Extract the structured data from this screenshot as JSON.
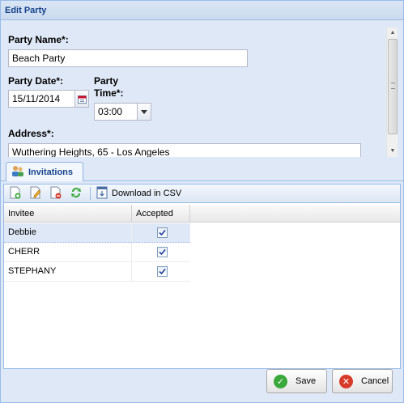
{
  "window": {
    "title": "Edit Party"
  },
  "form": {
    "party_name_label": "Party Name*:",
    "party_name_value": "Beach Party",
    "party_date_label": "Party Date*:",
    "party_date_value": "15/11/2014",
    "party_time_label_line1": "Party",
    "party_time_label_line2": "Time*:",
    "party_time_value": "03:00",
    "address_label": "Address*:",
    "address_value": "Wuthering Heights, 65 - Los Angeles"
  },
  "tabs": [
    {
      "label": "Invitations"
    }
  ],
  "toolbar": {
    "download_label": "Download in CSV"
  },
  "grid": {
    "columns": [
      "Invitee",
      "Accepted"
    ],
    "rows": [
      {
        "invitee": "Debbie",
        "accepted": true
      },
      {
        "invitee": "CHERR",
        "accepted": true
      },
      {
        "invitee": "STEPHANY",
        "accepted": true
      }
    ]
  },
  "buttons": {
    "save": "Save",
    "cancel": "Cancel"
  },
  "colors": {
    "accent": "#15428b",
    "panel": "#dfe8f6",
    "border": "#99bbe8"
  }
}
